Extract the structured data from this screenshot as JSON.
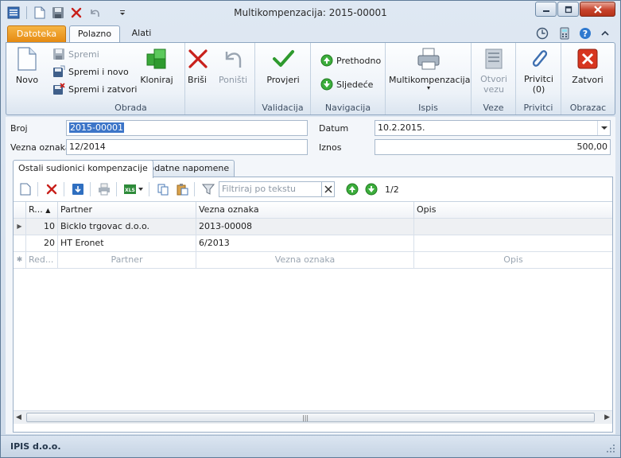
{
  "window": {
    "title": "Multikompenzacija: 2015-00001"
  },
  "tabs": {
    "file": "Datoteka",
    "home": "Polazno",
    "tools": "Alati"
  },
  "ribbon": {
    "obrada": {
      "label": "Obrada",
      "novo": "Novo",
      "spremi": "Spremi",
      "spremi_i_novo": "Spremi i novo",
      "spremi_i_zatvori": "Spremi i zatvori",
      "kloniraj": "Kloniraj",
      "brisi": "Briši",
      "ponisti": "Poništi"
    },
    "validacija": {
      "label": "Validacija",
      "provjeri": "Provjeri"
    },
    "navigacija": {
      "label": "Navigacija",
      "prethodno": "Prethodno",
      "sljedece": "Sljedeće"
    },
    "ispis": {
      "label": "Ispis",
      "multikompenzacija": "Multikompenzacija"
    },
    "veze": {
      "label": "Veze",
      "otvori_vezu_1": "Otvori",
      "otvori_vezu_2": "vezu"
    },
    "privitci": {
      "label": "Privitci",
      "privitci_1": "Privitci",
      "privitci_2": "(0)"
    },
    "obrazac": {
      "label": "Obrazac",
      "zatvori": "Zatvori"
    }
  },
  "form": {
    "broj_label": "Broj",
    "broj_value": "2015-00001",
    "vezna_oznaka_label": "Vezna oznaka",
    "vezna_oznaka_value": "12/2014",
    "datum_label": "Datum",
    "datum_value": "10.2.2015.",
    "iznos_label": "Iznos",
    "iznos_value": "500,00"
  },
  "inner_tabs": {
    "ostali": "Ostali sudionici kompenzacije",
    "napomene": "Dodatne napomene"
  },
  "grid_toolbar": {
    "filter_placeholder": "Filtriraj po tekstu",
    "record_count": "1/2"
  },
  "grid": {
    "headers": [
      "R...",
      "Partner",
      "Vezna oznaka",
      "Opis"
    ],
    "rows": [
      {
        "r": "10",
        "partner": "Bicklo trgovac d.o.o.",
        "vezna": "2013-00008",
        "opis": ""
      },
      {
        "r": "20",
        "partner": "HT Eronet",
        "vezna": "6/2013",
        "opis": ""
      }
    ],
    "new_row": [
      "Red...",
      "Partner",
      "Vezna oznaka",
      "Opis"
    ]
  },
  "status": {
    "company": "IPIS d.o.o."
  }
}
